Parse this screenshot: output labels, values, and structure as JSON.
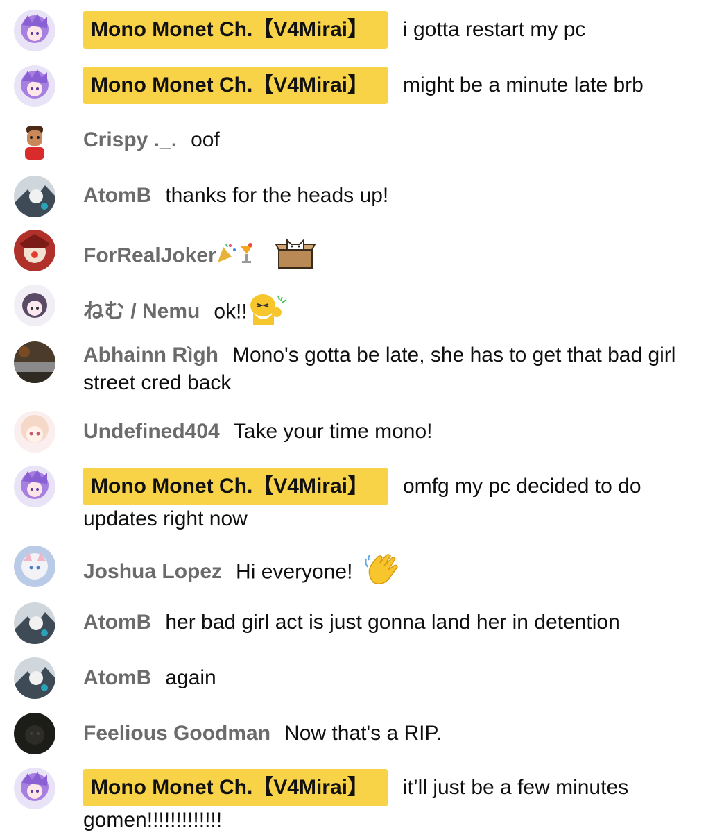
{
  "colors": {
    "owner_badge_bg": "#f8d347",
    "author_gray": "#6b6b6b",
    "text": "#0f0f0f",
    "background": "#ffffff"
  },
  "messages": [
    {
      "author": "Mono Monet Ch.【V4Mirai】",
      "text": "i gotta restart my pc",
      "owner": true,
      "avatar": "mono-avatar"
    },
    {
      "author": "Mono Monet Ch.【V4Mirai】",
      "text": "might be a minute late brb",
      "owner": true,
      "avatar": "mono-avatar"
    },
    {
      "author": "Crispy ._.",
      "text": "oof",
      "owner": false,
      "avatar": "crispy-avatar"
    },
    {
      "author": "AtomB",
      "text": "thanks for the heads up!",
      "owner": false,
      "avatar": "atomb-avatar"
    },
    {
      "author": "ForRealJoker",
      "text": "",
      "owner": false,
      "avatar": "forrealjoker-avatar",
      "emojis": [
        "party-popper-icon",
        "tropical-drink-icon",
        "cat-in-box-emote"
      ]
    },
    {
      "author": "ねむ / Nemu",
      "text": "ok!!",
      "owner": false,
      "avatar": "nemu-avatar",
      "emojis": [
        "yellow-mascot-emote"
      ]
    },
    {
      "author": "Abhainn Rìgh",
      "text": "Mono's gotta be late, she has to get that bad girl street cred back",
      "owner": false,
      "avatar": "abhainn-avatar"
    },
    {
      "author": "Undefined404",
      "text": "Take your time mono!",
      "owner": false,
      "avatar": "undefined404-avatar"
    },
    {
      "author": "Mono Monet Ch.【V4Mirai】",
      "text": "omfg my pc decided to do updates right now",
      "owner": true,
      "avatar": "mono-avatar"
    },
    {
      "author": "Joshua Lopez",
      "text": "Hi everyone!",
      "owner": false,
      "avatar": "joshua-avatar",
      "emojis": [
        "waving-hand-icon"
      ]
    },
    {
      "author": "AtomB",
      "text": "her bad girl act is just gonna land her in detention",
      "owner": false,
      "avatar": "atomb-avatar"
    },
    {
      "author": "AtomB",
      "text": "again",
      "owner": false,
      "avatar": "atomb-avatar"
    },
    {
      "author": "Feelious Goodman",
      "text": "Now that's a RIP.",
      "owner": false,
      "avatar": "feelious-avatar"
    },
    {
      "author": "Mono Monet Ch.【V4Mirai】",
      "text": "it’ll just be a few minutes gomen!!!!!!!!!!!!!",
      "owner": true,
      "avatar": "mono-avatar"
    }
  ]
}
